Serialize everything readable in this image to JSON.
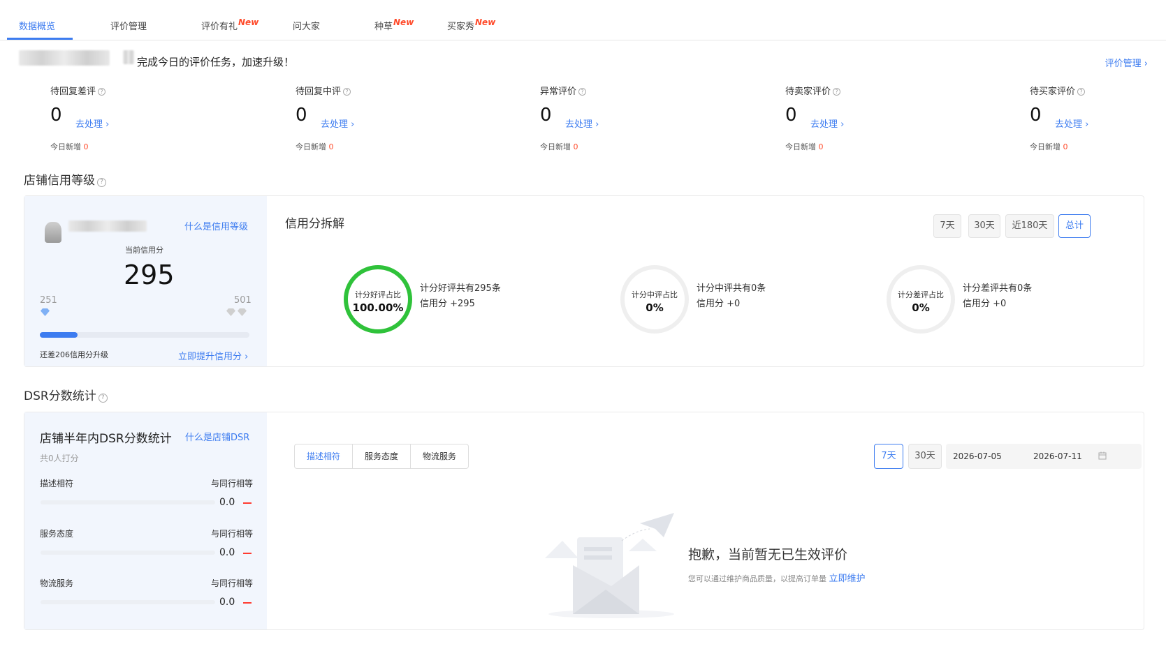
{
  "tabs": [
    {
      "label": "数据概览",
      "active": true,
      "new": false
    },
    {
      "label": "评价管理",
      "active": false,
      "new": false
    },
    {
      "label": "评价有礼",
      "active": false,
      "new": true
    },
    {
      "label": "问大家",
      "active": false,
      "new": false
    },
    {
      "label": "种草",
      "active": false,
      "new": true
    },
    {
      "label": "买家秀",
      "active": false,
      "new": true
    }
  ],
  "new_tag": "New",
  "task": {
    "text": "完成今日的评价任务，加速升级！",
    "manage_link": "评价管理 ›"
  },
  "metrics": [
    {
      "label": "待回复差评",
      "value": "0",
      "action": "去处理 ›",
      "today_label": "今日新增",
      "today_value": "0"
    },
    {
      "label": "待回复中评",
      "value": "0",
      "action": "去处理 ›",
      "today_label": "今日新增",
      "today_value": "0"
    },
    {
      "label": "异常评价",
      "value": "0",
      "action": "去处理 ›",
      "today_label": "今日新增",
      "today_value": "0"
    },
    {
      "label": "待卖家评价",
      "value": "0",
      "action": "去处理 ›",
      "today_label": "今日新增",
      "today_value": "0"
    },
    {
      "label": "待买家评价",
      "value": "0",
      "action": "去处理 ›",
      "today_label": "今日新增",
      "today_value": "0"
    }
  ],
  "credit": {
    "section_title": "店铺信用等级",
    "what_link": "什么是信用等级",
    "current_label": "当前信用分",
    "score": "295",
    "min": "251",
    "max": "501",
    "progress": 0.18,
    "gap_text": "还差206信用分升级",
    "boost_link": "立即提升信用分 ›",
    "breakdown_title": "信用分拆解",
    "ranges": [
      "7天",
      "30天",
      "近180天",
      "总计"
    ],
    "active_range": "总计",
    "rings": [
      {
        "label": "计分好评占比",
        "value": "100.00%",
        "desc1": "计分好评共有295条",
        "desc2": "信用分 +295",
        "color": "#2fc23a"
      },
      {
        "label": "计分中评占比",
        "value": "0%",
        "desc1": "计分中评共有0条",
        "desc2": "信用分 +0",
        "color": "#efefef"
      },
      {
        "label": "计分差评占比",
        "value": "0%",
        "desc1": "计分差评共有0条",
        "desc2": "信用分 +0",
        "color": "#efefef"
      }
    ]
  },
  "dsr": {
    "section_title": "DSR分数统计",
    "panel_title": "店铺半年内DSR分数统计",
    "what_link": "什么是店铺DSR",
    "count_text": "共0人打分",
    "rows": [
      {
        "label": "描述相符",
        "compare": "与同行相等",
        "value": "0.0"
      },
      {
        "label": "服务态度",
        "compare": "与同行相等",
        "value": "0.0"
      },
      {
        "label": "物流服务",
        "compare": "与同行相等",
        "value": "0.0"
      }
    ],
    "segments": [
      "描述相符",
      "服务态度",
      "物流服务"
    ],
    "active_segment": "描述相符",
    "ranges": [
      "7天",
      "30天"
    ],
    "active_range": "7天",
    "date_start": "2026-07-05",
    "date_end": "2026-07-11",
    "empty_title": "抱歉，当前暂无已生效评价",
    "empty_desc": "您可以通过维护商品质量，以提高订单量",
    "empty_link": "立即维护"
  },
  "icons": {
    "help": "question-circle-icon",
    "calendar": "calendar-icon",
    "diamond_blue": "#7fb0f5",
    "diamond_gray": "#cfcfcf"
  }
}
